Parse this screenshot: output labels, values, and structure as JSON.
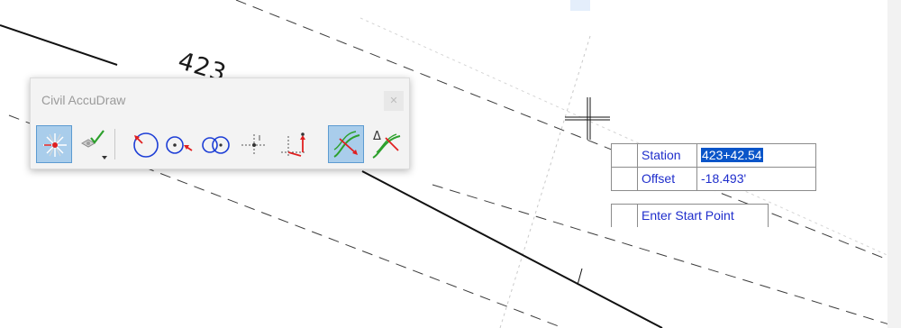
{
  "drawing": {
    "station_text": "423"
  },
  "toolbar": {
    "title": "Civil AccuDraw",
    "tools": [
      {
        "icon": "accudraw-origin-icon",
        "active": true
      },
      {
        "icon": "check-rotation-icon",
        "active": false
      },
      {
        "icon": "circle-pick-icon",
        "active": false
      },
      {
        "icon": "point-circle-icon",
        "active": false
      },
      {
        "icon": "double-circle-icon",
        "active": false
      },
      {
        "icon": "perpendicular-point-icon",
        "active": false
      },
      {
        "icon": "offset-point-icon",
        "active": false
      },
      {
        "icon": "station-offset-icon",
        "active": true
      },
      {
        "icon": "delta-station-icon",
        "active": false
      }
    ]
  },
  "prompt": {
    "station_label": "Station",
    "station_value": "423+42.54",
    "offset_label": "Offset",
    "offset_value": "-18.493'",
    "message": "Enter Start Point"
  },
  "colors": {
    "accent": "#0a55c9",
    "prompt_text": "#1f2ecc",
    "tool_active": "#a9cdeb"
  }
}
